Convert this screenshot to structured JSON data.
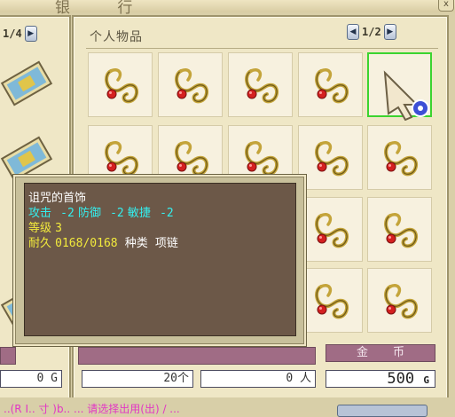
{
  "window": {
    "title": "银 行",
    "close_label": "x"
  },
  "left_panel": {
    "page": "1/4",
    "prev_label": "◀",
    "next_label": "▶",
    "card_count": 6
  },
  "inventory": {
    "title": "个人物品",
    "page": "1/2",
    "prev_label": "◀",
    "next_label": "▶",
    "item_name": "诅咒的首饰",
    "slot_count": 20,
    "selected_slot": 5
  },
  "tooltip": {
    "name": "诅咒的首饰",
    "attack_label": "攻击",
    "attack_value": "-2",
    "defense_label": "防御",
    "defense_value": "-2",
    "agility_label": "敏捷",
    "agility_value": "-2",
    "level_label": "等级",
    "level_value": "3",
    "durability_label": "耐久",
    "durability_value": "0168/0168",
    "type_label": "种类",
    "type_value": "项链"
  },
  "footer": {
    "gold_label": "金币",
    "gold_amount": "500",
    "gold_unit": "G",
    "left_value": "0 G",
    "mid_value_1": "20个",
    "mid_value_2": "0 人",
    "hint_text": "..(R I.. 寸 )b..    ... 请选择出用(出)   / ..."
  },
  "colors": {
    "selected_border": "#3bd42f",
    "tooltip_bg": "#6c5848",
    "stat_cyan": "#33f0f0",
    "stat_yellow": "#f2ea3c",
    "gold_label_bg": "#a06c85"
  }
}
